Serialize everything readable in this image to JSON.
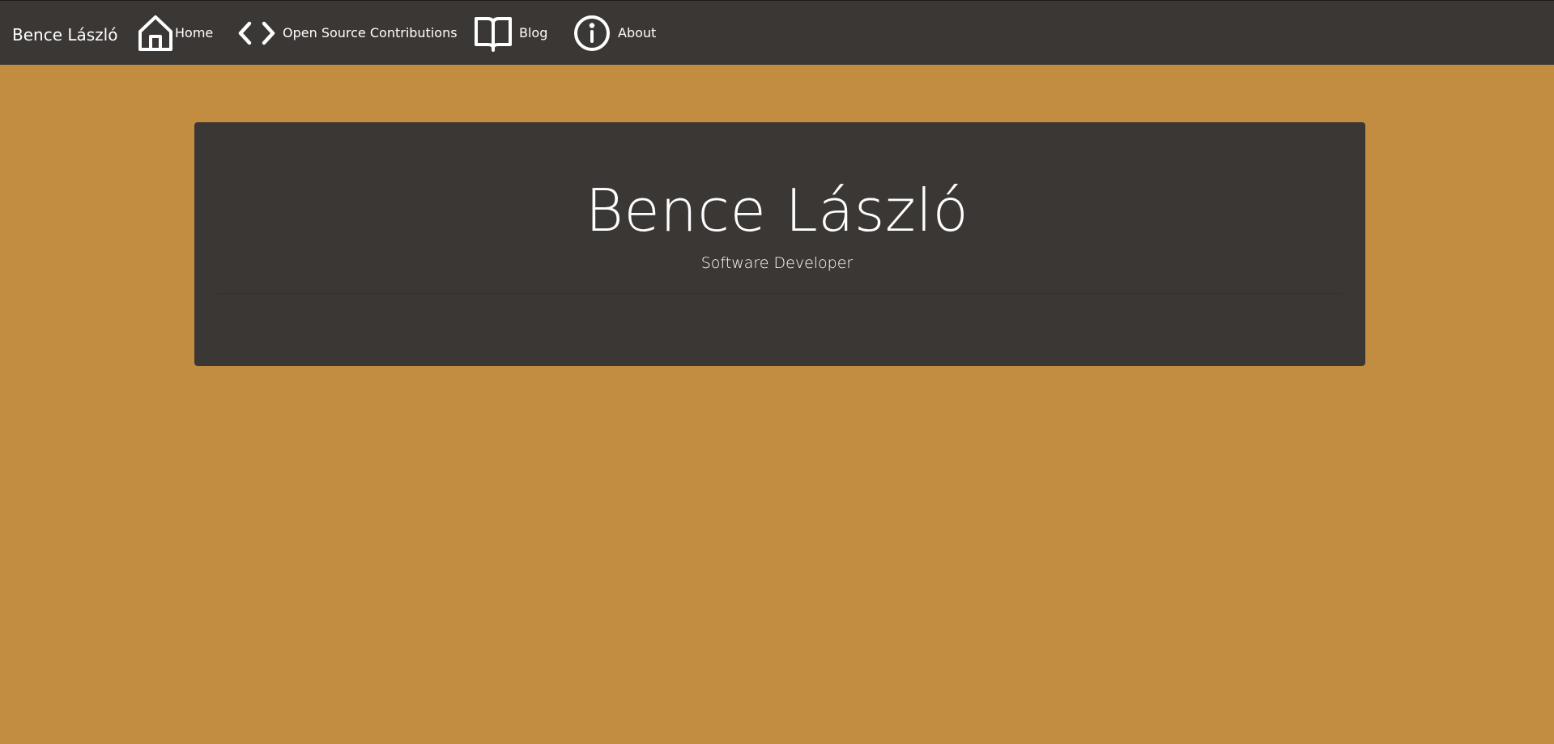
{
  "nav": {
    "brand": "Bence László",
    "items": [
      {
        "label": "Home",
        "icon": "home-icon"
      },
      {
        "label": "Open Source Contributions",
        "icon": "code-icon"
      },
      {
        "label": "Blog",
        "icon": "book-icon"
      },
      {
        "label": "About",
        "icon": "info-icon"
      }
    ]
  },
  "hero": {
    "title": "Bence László",
    "subtitle": "Software Developer"
  },
  "colors": {
    "background": "#c28d40",
    "panel": "#3b3735",
    "text": "#ffffff"
  }
}
